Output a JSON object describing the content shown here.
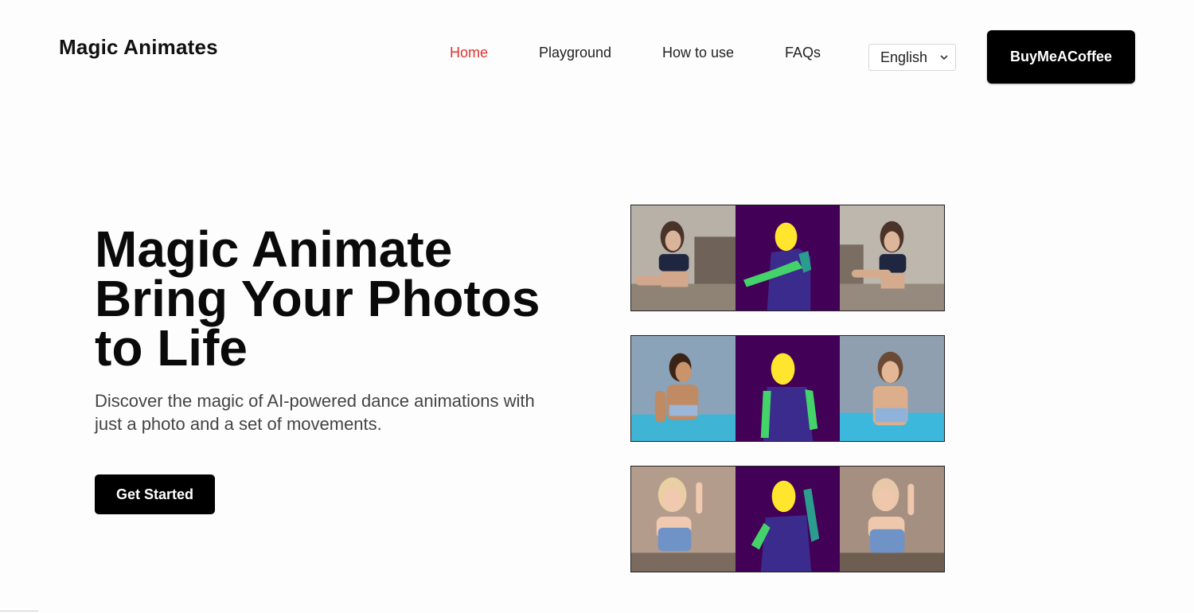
{
  "brand": "Magic Animates",
  "nav": {
    "home": "Home",
    "playground": "Playground",
    "how_to_use": "How to use",
    "faqs": "FAQs"
  },
  "language": {
    "selected": "English"
  },
  "buy_button": "BuyMeACoffee",
  "hero": {
    "title_line1": "Magic Animate",
    "title_line2": "Bring Your Photos",
    "title_line3": "to Life",
    "subtitle": "Discover the magic of AI-powered dance animations with just a photo and a set of movements.",
    "cta": "Get Started"
  },
  "colors": {
    "accent": "#e0312e",
    "pose_background": "#430057",
    "pose_head": "#ffe52d",
    "pose_limb": "#44d36a",
    "pose_torso": "#3b2b8c"
  },
  "icons": {
    "language_dropdown": "chevron-down-icon"
  }
}
